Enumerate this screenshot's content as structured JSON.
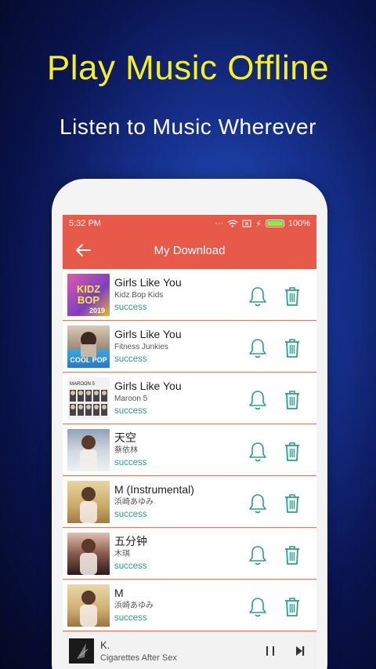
{
  "promo": {
    "title": "Play Music Offline",
    "subtitle": "Listen to Music Wherever"
  },
  "statusbar": {
    "time": "5:32 PM",
    "battery": "100%",
    "battery_level": 1.0
  },
  "appbar": {
    "title": "My Download",
    "back_icon": "arrow-left-icon"
  },
  "colors": {
    "accent": "#e75a4a",
    "success": "#2a9d8f",
    "promo_yellow": "#f6f021"
  },
  "downloads": [
    {
      "title": "Girls Like You",
      "artist": "Kidz Bop Kids",
      "status": "success",
      "art_text": "KIDZ BOP 2019"
    },
    {
      "title": "Girls Like You",
      "artist": "Fitness Junkies",
      "status": "success",
      "art_text": "COOL POP"
    },
    {
      "title": "Girls Like You",
      "artist": "Maroon 5",
      "status": "success",
      "art_text": "MAROON 5"
    },
    {
      "title": "天空",
      "artist": "蔡依林",
      "status": "success"
    },
    {
      "title": "M (Instrumental)",
      "artist": "浜崎あゆみ",
      "status": "success"
    },
    {
      "title": "五分钟",
      "artist": "木琪",
      "status": "success"
    },
    {
      "title": "M",
      "artist": "浜崎あゆみ",
      "status": "success"
    }
  ],
  "player": {
    "title": "K.",
    "artist": "Cigarettes After Sex"
  }
}
